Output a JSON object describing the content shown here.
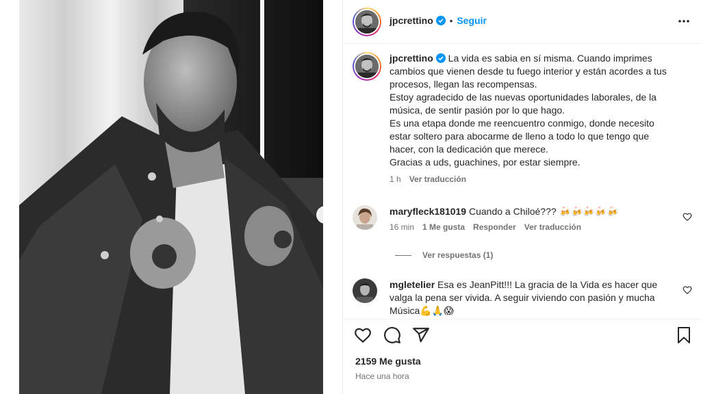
{
  "post": {
    "username": "jpcrettino",
    "follow_label": "Seguir",
    "separator": "•",
    "caption_lines": [
      "La vida es sabia en sí misma. Cuando imprimes",
      "cambios que vienen desde tu fuego interior y están acordes a tus",
      "procesos, llegan las recompensas.",
      "Estoy agradecido de las nuevas oportunidades laborales, de la",
      "música, de sentir pasión por lo que hago.",
      "Es una etapa donde me reencuentro conmigo, donde necesito",
      "estar soltero para abocarme de lleno a todo lo que tengo que",
      "hacer, con la dedicación que merece.",
      "Gracias a uds, guachines, por estar siempre."
    ],
    "caption_time": "1 h",
    "caption_translate": "Ver traducción",
    "likes": "2159 Me gusta",
    "posted": "Hace una hora"
  },
  "comments": [
    {
      "username": "maryfleck181019",
      "text": "Cuando a Chiloé??? 🍻🍻🍻🍻🍻",
      "time": "16 min",
      "likes": "1 Me gusta",
      "reply": "Responder",
      "translate": "Ver traducción",
      "replies": "Ver respuestas (1)"
    },
    {
      "username": "mgletelier",
      "text_lines": [
        "Esa es JeanPitt!!! La gracia de la Vida es hacer que",
        "valga la pena ser vivida. A seguir viviendo con pasión y mucha",
        "Música💪🙏😱"
      ]
    }
  ],
  "colors": {
    "accent": "#0095f6",
    "verified": "#0095f6",
    "secondary_text": "#737373"
  },
  "icons": [
    "verified-badge-icon",
    "more-options-icon",
    "heart-icon",
    "comment-icon",
    "share-icon",
    "bookmark-icon",
    "chevron-right-icon"
  ]
}
